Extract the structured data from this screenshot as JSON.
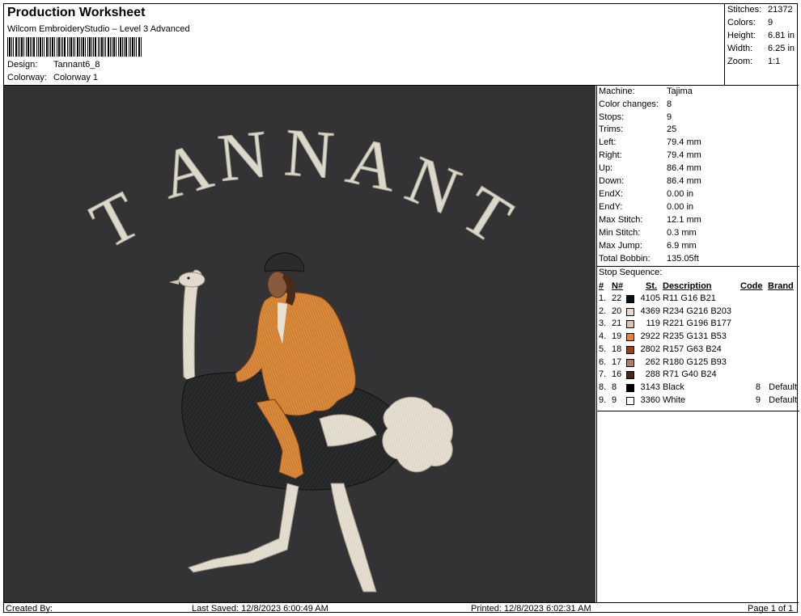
{
  "header": {
    "title": "Production Worksheet",
    "subtitle": "Wilcom EmbroideryStudio – Level 3 Advanced",
    "design_label": "Design:",
    "design_value": "Tannant6_8",
    "colorway_label": "Colorway:",
    "colorway_value": "Colorway 1"
  },
  "summary": [
    {
      "label": "Stitches:",
      "value": "21372"
    },
    {
      "label": "Colors:",
      "value": "9"
    },
    {
      "label": "Height:",
      "value": "6.81 in"
    },
    {
      "label": "Width:",
      "value": "6.25 in"
    },
    {
      "label": "Zoom:",
      "value": "1:1"
    }
  ],
  "design_text": "TANNANT",
  "machine_info": [
    {
      "label": "Machine:",
      "value": "Tajima"
    },
    {
      "label": "Color changes:",
      "value": "8"
    },
    {
      "label": "Stops:",
      "value": "9"
    },
    {
      "label": "Trims:",
      "value": "25"
    },
    {
      "label": "Left:",
      "value": "79.4 mm"
    },
    {
      "label": "Right:",
      "value": "79.4 mm"
    },
    {
      "label": "Up:",
      "value": "86.4 mm"
    },
    {
      "label": "Down:",
      "value": "86.4 mm"
    },
    {
      "label": "EndX:",
      "value": "0.00 in"
    },
    {
      "label": "EndY:",
      "value": "0.00 in"
    },
    {
      "label": "Max Stitch:",
      "value": "12.1 mm"
    },
    {
      "label": "Min Stitch:",
      "value": "0.3 mm"
    },
    {
      "label": "Max Jump:",
      "value": "6.9 mm"
    },
    {
      "label": "Total Bobbin:",
      "value": "135.05ft"
    }
  ],
  "stop_sequence": {
    "title": "Stop Sequence:",
    "columns": {
      "num": "#",
      "n": "N#",
      "st": "St.",
      "description": "Description",
      "code": "Code",
      "brand": "Brand"
    },
    "rows": [
      {
        "num": "1.",
        "n": "22",
        "color": "#0b1015",
        "st": "4105",
        "description": "R11 G16 B21",
        "code": "",
        "brand": ""
      },
      {
        "num": "2.",
        "n": "20",
        "color": "#ead8cb",
        "st": "4369",
        "description": "R234 G216 B203",
        "code": "",
        "brand": ""
      },
      {
        "num": "3.",
        "n": "21",
        "color": "#ddc4b1",
        "st": "119",
        "description": "R221 G196 B177",
        "code": "",
        "brand": ""
      },
      {
        "num": "4.",
        "n": "19",
        "color": "#eb8335",
        "st": "2922",
        "description": "R235 G131 B53",
        "code": "",
        "brand": ""
      },
      {
        "num": "5.",
        "n": "18",
        "color": "#9d3f18",
        "st": "2802",
        "description": "R157 G63 B24",
        "code": "",
        "brand": ""
      },
      {
        "num": "6.",
        "n": "17",
        "color": "#b47d5d",
        "st": "262",
        "description": "R180 G125 B93",
        "code": "",
        "brand": ""
      },
      {
        "num": "7.",
        "n": "16",
        "color": "#472818",
        "st": "288",
        "description": "R71 G40 B24",
        "code": "",
        "brand": ""
      },
      {
        "num": "8.",
        "n": "8",
        "color": "#000000",
        "st": "3143",
        "description": "Black",
        "code": "8",
        "brand": "Default"
      },
      {
        "num": "9.",
        "n": "9",
        "color": "#ffffff",
        "st": "3360",
        "description": "White",
        "code": "9",
        "brand": "Default"
      }
    ]
  },
  "footer": {
    "created_by": "Created By:",
    "last_saved": "Last Saved: 12/8/2023 6:00:49 AM",
    "printed": "Printed: 12/8/2023 6:02:31 AM",
    "page": "Page 1 of 1"
  }
}
